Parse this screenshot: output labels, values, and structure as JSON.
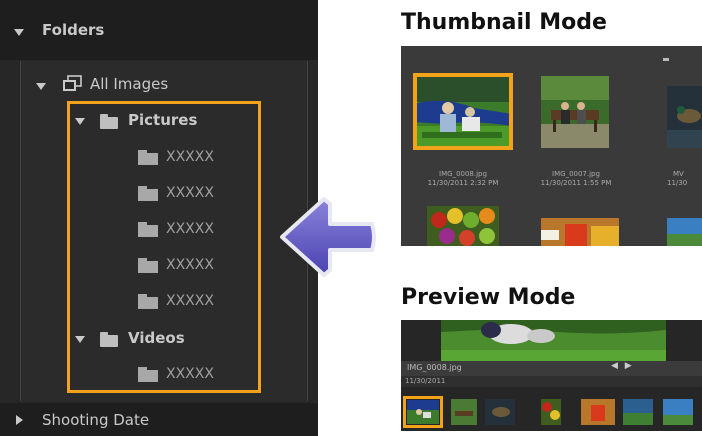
{
  "sidebar": {
    "folders_header": "Folders",
    "all_images": "All Images",
    "pictures": "Pictures",
    "picture_subfolders": [
      "XXXXX",
      "XXXXX",
      "XXXXX",
      "XXXXX",
      "XXXXX"
    ],
    "videos": "Videos",
    "video_subfolders": [
      "XXXXX"
    ],
    "shooting_date": "Shooting Date"
  },
  "thumbnail_mode": {
    "title": "Thumbnail Mode",
    "items": [
      {
        "name": "IMG_0008.jpg",
        "date": "11/30/2011 2:32 PM"
      },
      {
        "name": "IMG_0007.jpg",
        "date": "11/30/2011 1:55 PM"
      },
      {
        "name": "MV",
        "date": "11/30"
      }
    ]
  },
  "preview_mode": {
    "title": "Preview Mode",
    "filename": "IMG_0008.jpg",
    "date": "11/30/2011",
    "nav": "◀ ▶"
  },
  "colors": {
    "highlight": "#f2a31a",
    "arrow": "#5c55c4",
    "panel_bg": "#272727"
  }
}
